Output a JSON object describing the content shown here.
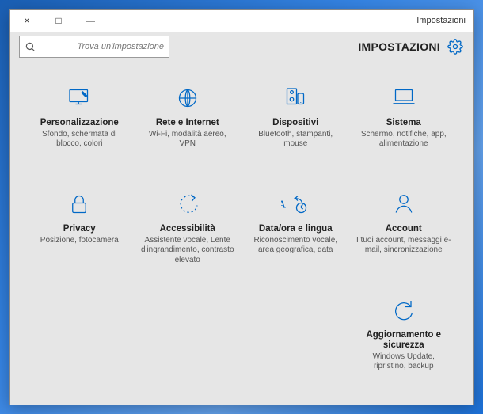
{
  "window": {
    "caption": "Impostazioni",
    "close": "×",
    "maximize": "□",
    "minimize": "—"
  },
  "header": {
    "title": "IMPOSTAZIONI"
  },
  "search": {
    "placeholder": "Trova un'impostazione"
  },
  "tiles": [
    {
      "key": "system",
      "title": "Sistema",
      "sub": "Schermo, notifiche, app, alimentazione"
    },
    {
      "key": "devices",
      "title": "Dispositivi",
      "sub": "Bluetooth, stampanti, mouse"
    },
    {
      "key": "network",
      "title": "Rete e Internet",
      "sub": "Wi-Fi, modalità aereo, VPN"
    },
    {
      "key": "personal",
      "title": "Personalizzazione",
      "sub": "Sfondo, schermata di blocco, colori"
    },
    {
      "key": "accounts",
      "title": "Account",
      "sub": "I tuoi account, messaggi e-mail, sincronizzazione"
    },
    {
      "key": "time",
      "title": "Data/ora e lingua",
      "sub": "Riconoscimento vocale, area geografica, data"
    },
    {
      "key": "access",
      "title": "Accessibilità",
      "sub": "Assistente vocale, Lente d'ingrandimento, contrasto elevato"
    },
    {
      "key": "privacy",
      "title": "Privacy",
      "sub": "Posizione, fotocamera"
    },
    {
      "key": "update",
      "title": "Aggiornamento e sicurezza",
      "sub": "Windows Update, ripristino, backup"
    }
  ],
  "colors": {
    "accent": "#0068c6"
  }
}
